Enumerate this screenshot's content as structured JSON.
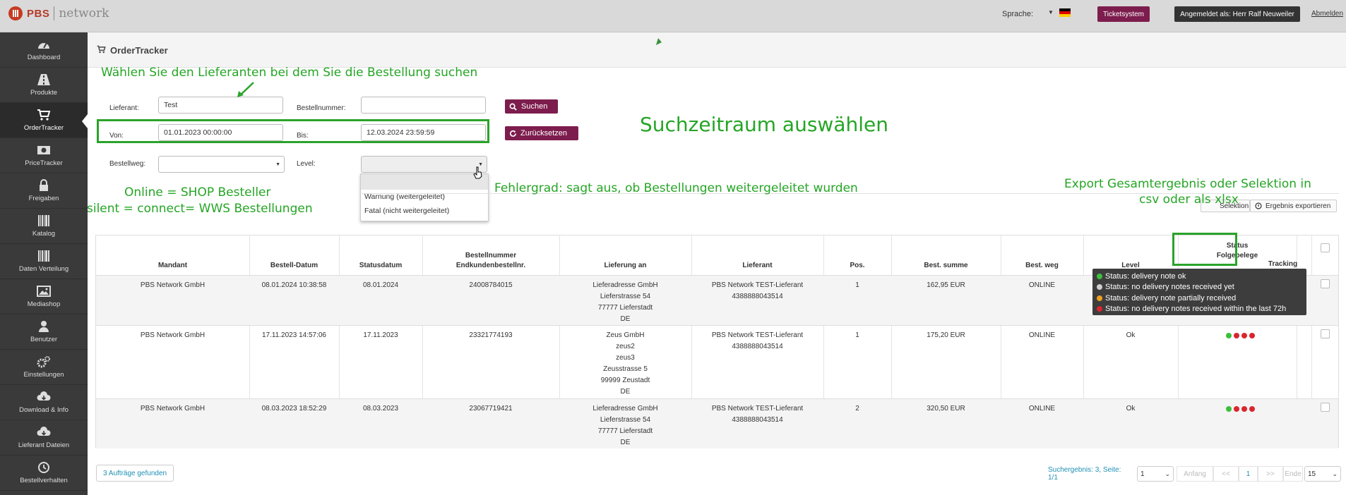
{
  "header": {
    "logo_brand": "PBS",
    "logo_network": "network",
    "language_label": "Sprache:",
    "ticket_button": "Ticketsystem",
    "user_button": "Angemeldet als: Herr Ralf Neuweiler",
    "logout_link": "Abmelden"
  },
  "sidebar": {
    "items": [
      {
        "label": "Dashboard",
        "icon": "dashboard-icon"
      },
      {
        "label": "Produkte",
        "icon": "road-icon"
      },
      {
        "label": "OrderTracker",
        "icon": "cart-icon"
      },
      {
        "label": "PriceTracker",
        "icon": "money-icon"
      },
      {
        "label": "Freigaben",
        "icon": "lock-icon"
      },
      {
        "label": "Katalog",
        "icon": "barcode-icon"
      },
      {
        "label": "Daten Verteilung",
        "icon": "barcode-icon"
      },
      {
        "label": "Mediashop",
        "icon": "image-icon"
      },
      {
        "label": "Benutzer",
        "icon": "user-icon"
      },
      {
        "label": "Einstellungen",
        "icon": "gears-icon"
      },
      {
        "label": "Download & Info",
        "icon": "cloud-download-icon"
      },
      {
        "label": "Lieferant Dateien",
        "icon": "cloud-download-icon"
      },
      {
        "label": "Bestellverhalten",
        "icon": "clock-icon"
      }
    ]
  },
  "page": {
    "title": "OrderTracker"
  },
  "filter": {
    "lieferant_label": "Lieferant:",
    "lieferant_value": "Test",
    "bestellnummer_label": "Bestellnummer:",
    "bestellnummer_value": "",
    "von_label": "Von:",
    "von_value": "01.01.2023 00:00:00",
    "bis_label": "Bis:",
    "bis_value": "12.03.2024 23:59:59",
    "bestellweg_label": "Bestellweg:",
    "level_label": "Level:",
    "search_button": "Suchen",
    "reset_button": "Zurücksetzen",
    "level_options": [
      "",
      "Warnung (weitergeleitet)",
      "Fatal (nicht weitergeleitet)"
    ]
  },
  "annotations": {
    "lieferant_hint": "Wählen Sie den Lieferanten bei dem Sie die Bestellung suchen",
    "zeitraum_hint": "Suchzeitraum auswählen",
    "bestellweg_hint_1": "Online = SHOP Besteller",
    "bestellweg_hint_2": "silent = connect= WWS Bestellungen",
    "level_hint": "Fehlergrad: sagt aus, ob Bestellungen weitergeleitet wurden",
    "export_hint_1": "Export Gesamtergebnis oder Selektion in",
    "export_hint_2": "csv oder als xlsx"
  },
  "export": {
    "selection_button": "Selektion",
    "all_button": "Ergebnis exportieren"
  },
  "table": {
    "headers": {
      "mandant": "Mandant",
      "bestell_datum": "Bestell-Datum",
      "statusdatum": "Statusdatum",
      "bestellnummer_1": "Bestellnummer",
      "bestellnummer_2": "Endkundenbestellnr.",
      "lieferung_an": "Lieferung an",
      "lieferant": "Lieferant",
      "pos": "Pos.",
      "best_summe": "Best. summe",
      "best_weg": "Best. weg",
      "level": "Level",
      "status_1": "Status",
      "status_2": "Folgebelege",
      "tracking": "Tracking"
    },
    "rows": [
      {
        "mandant": "PBS Network GmbH",
        "bestell_datum": "08.01.2024 10:38:58",
        "statusdatum": "08.01.2024",
        "bestellnummer": "24008784015",
        "lieferung": [
          "Lieferadresse GmbH",
          "Lieferstrasse 54",
          "77777 Lieferstadt",
          "DE"
        ],
        "lieferant": [
          "PBS Network TEST-Lieferant",
          "4388888043514"
        ],
        "pos": "1",
        "summe": "162,95 EUR",
        "weg": "ONLINE",
        "level": "",
        "status": [
          "green",
          "red",
          "red",
          "red"
        ]
      },
      {
        "mandant": "PBS Network GmbH",
        "bestell_datum": "17.11.2023 14:57:06",
        "statusdatum": "17.11.2023",
        "bestellnummer": "23321774193",
        "lieferung": [
          "Zeus GmbH",
          "zeus2",
          "zeus3",
          "Zeusstrasse 5",
          "99999 Zeustadt",
          "DE"
        ],
        "lieferant": [
          "PBS Network TEST-Lieferant",
          "4388888043514"
        ],
        "pos": "1",
        "summe": "175,20 EUR",
        "weg": "ONLINE",
        "level": "Ok",
        "status": [
          "green",
          "red",
          "red",
          "red"
        ]
      },
      {
        "mandant": "PBS Network GmbH",
        "bestell_datum": "08.03.2023 18:52:29",
        "statusdatum": "08.03.2023",
        "bestellnummer": "23067719421",
        "lieferung": [
          "Lieferadresse GmbH",
          "Lieferstrasse 54",
          "77777 Lieferstadt",
          "DE"
        ],
        "lieferant": [
          "PBS Network TEST-Lieferant",
          "4388888043514"
        ],
        "pos": "2",
        "summe": "320,50 EUR",
        "weg": "ONLINE",
        "level": "Ok",
        "status": [
          "green",
          "red",
          "red",
          "red"
        ]
      }
    ]
  },
  "tooltip": {
    "lines": [
      {
        "text": "Status: delivery note ok",
        "color": "#3cbf3c"
      },
      {
        "text": "Status: no delivery notes received yet",
        "color": "#cfcfcf"
      },
      {
        "text": "Status: delivery note partially received",
        "color": "#f0a020"
      },
      {
        "text": "Status: no delivery notes received within the last 72h",
        "color": "#d9262e"
      }
    ]
  },
  "footer": {
    "found": "3 Aufträge gefunden",
    "result": "Suchergebnis: 3, Seite: 1/1",
    "page_select": "1",
    "first": "Anfang",
    "prev": "<<",
    "current": "1",
    "next": ">>",
    "last": "Ende",
    "per_page": "15"
  },
  "colors": {
    "accent": "#7d1d4d",
    "annotation": "#25a525",
    "sidebar": "#3a3a3a"
  }
}
